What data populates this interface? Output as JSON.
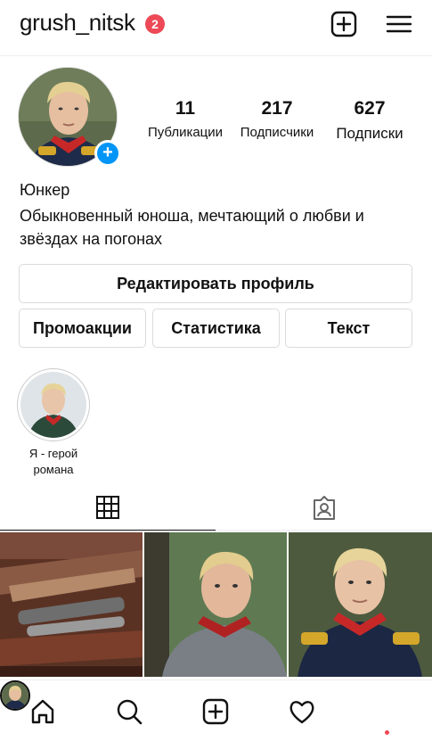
{
  "header": {
    "username": "grush_nitsk",
    "notification_count": "2",
    "icons": [
      "plus-square-icon",
      "menu-icon"
    ]
  },
  "stats": {
    "posts_value": "11",
    "posts_label": "Публикации",
    "followers_value": "217",
    "followers_label": "Подписчики",
    "following_value": "627",
    "following_label": "Подписки"
  },
  "bio": {
    "name": "Юнкер",
    "text": "Обыкновенный юноша, мечтающий о любви и звёздах на погонах"
  },
  "buttons": {
    "edit_profile": "Редактировать профиль",
    "promotions": "Промоакции",
    "insights": "Статистика",
    "text": "Текст"
  },
  "highlights": [
    {
      "label": "Я - герой романа"
    }
  ],
  "tabs": [
    "grid-icon",
    "tagged-icon"
  ],
  "bottom_nav": [
    "home-icon",
    "search-icon",
    "plus-square-icon",
    "heart-icon",
    "profile-avatar"
  ],
  "colors": {
    "badge": "#ed4956",
    "accent_blue": "#0095f6",
    "border": "#dbdbdb"
  }
}
